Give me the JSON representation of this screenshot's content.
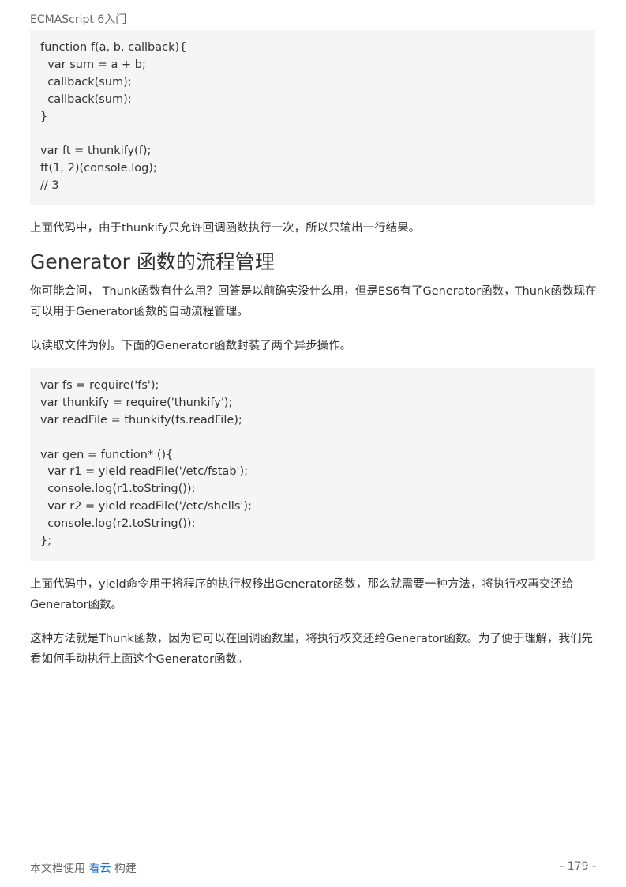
{
  "header": {
    "title": "ECMAScript 6入门"
  },
  "code_block_1": {
    "lines": [
      "function f(a, b, callback){",
      "  var sum = a + b;",
      "  callback(sum);",
      "  callback(sum);",
      "}",
      "",
      "var ft = thunkify(f);",
      "ft(1, 2)(console.log);",
      "// 3"
    ]
  },
  "paragraph_1": "上面代码中，由于thunkify只允许回调函数执行一次，所以只输出一行结果。",
  "section": {
    "heading": "Generator 函数的流程管理"
  },
  "paragraph_2": "你可能会问， Thunk函数有什么用？回答是以前确实没什么用，但是ES6有了Generator函数，Thunk函数现在可以用于Generator函数的自动流程管理。",
  "paragraph_3": "以读取文件为例。下面的Generator函数封装了两个异步操作。",
  "code_block_2": {
    "lines": [
      "var fs = require('fs');",
      "var thunkify = require('thunkify');",
      "var readFile = thunkify(fs.readFile);",
      "",
      "var gen = function* (){",
      "  var r1 = yield readFile('/etc/fstab');",
      "  console.log(r1.toString());",
      "  var r2 = yield readFile('/etc/shells');",
      "  console.log(r2.toString());",
      "};"
    ]
  },
  "paragraph_4": "上面代码中，yield命令用于将程序的执行权移出Generator函数，那么就需要一种方法，将执行权再交还给Generator函数。",
  "paragraph_5": "这种方法就是Thunk函数，因为它可以在回调函数里，将执行权交还给Generator函数。为了便于理解，我们先看如何手动执行上面这个Generator函数。",
  "footer": {
    "prefix": "本文档使用",
    "link_text": "看云",
    "suffix": "构建",
    "page_number": "- 179 -"
  },
  "colors": {
    "code_background": "#f5f5f5",
    "link": "#1a6fd1",
    "text": "#333333"
  }
}
